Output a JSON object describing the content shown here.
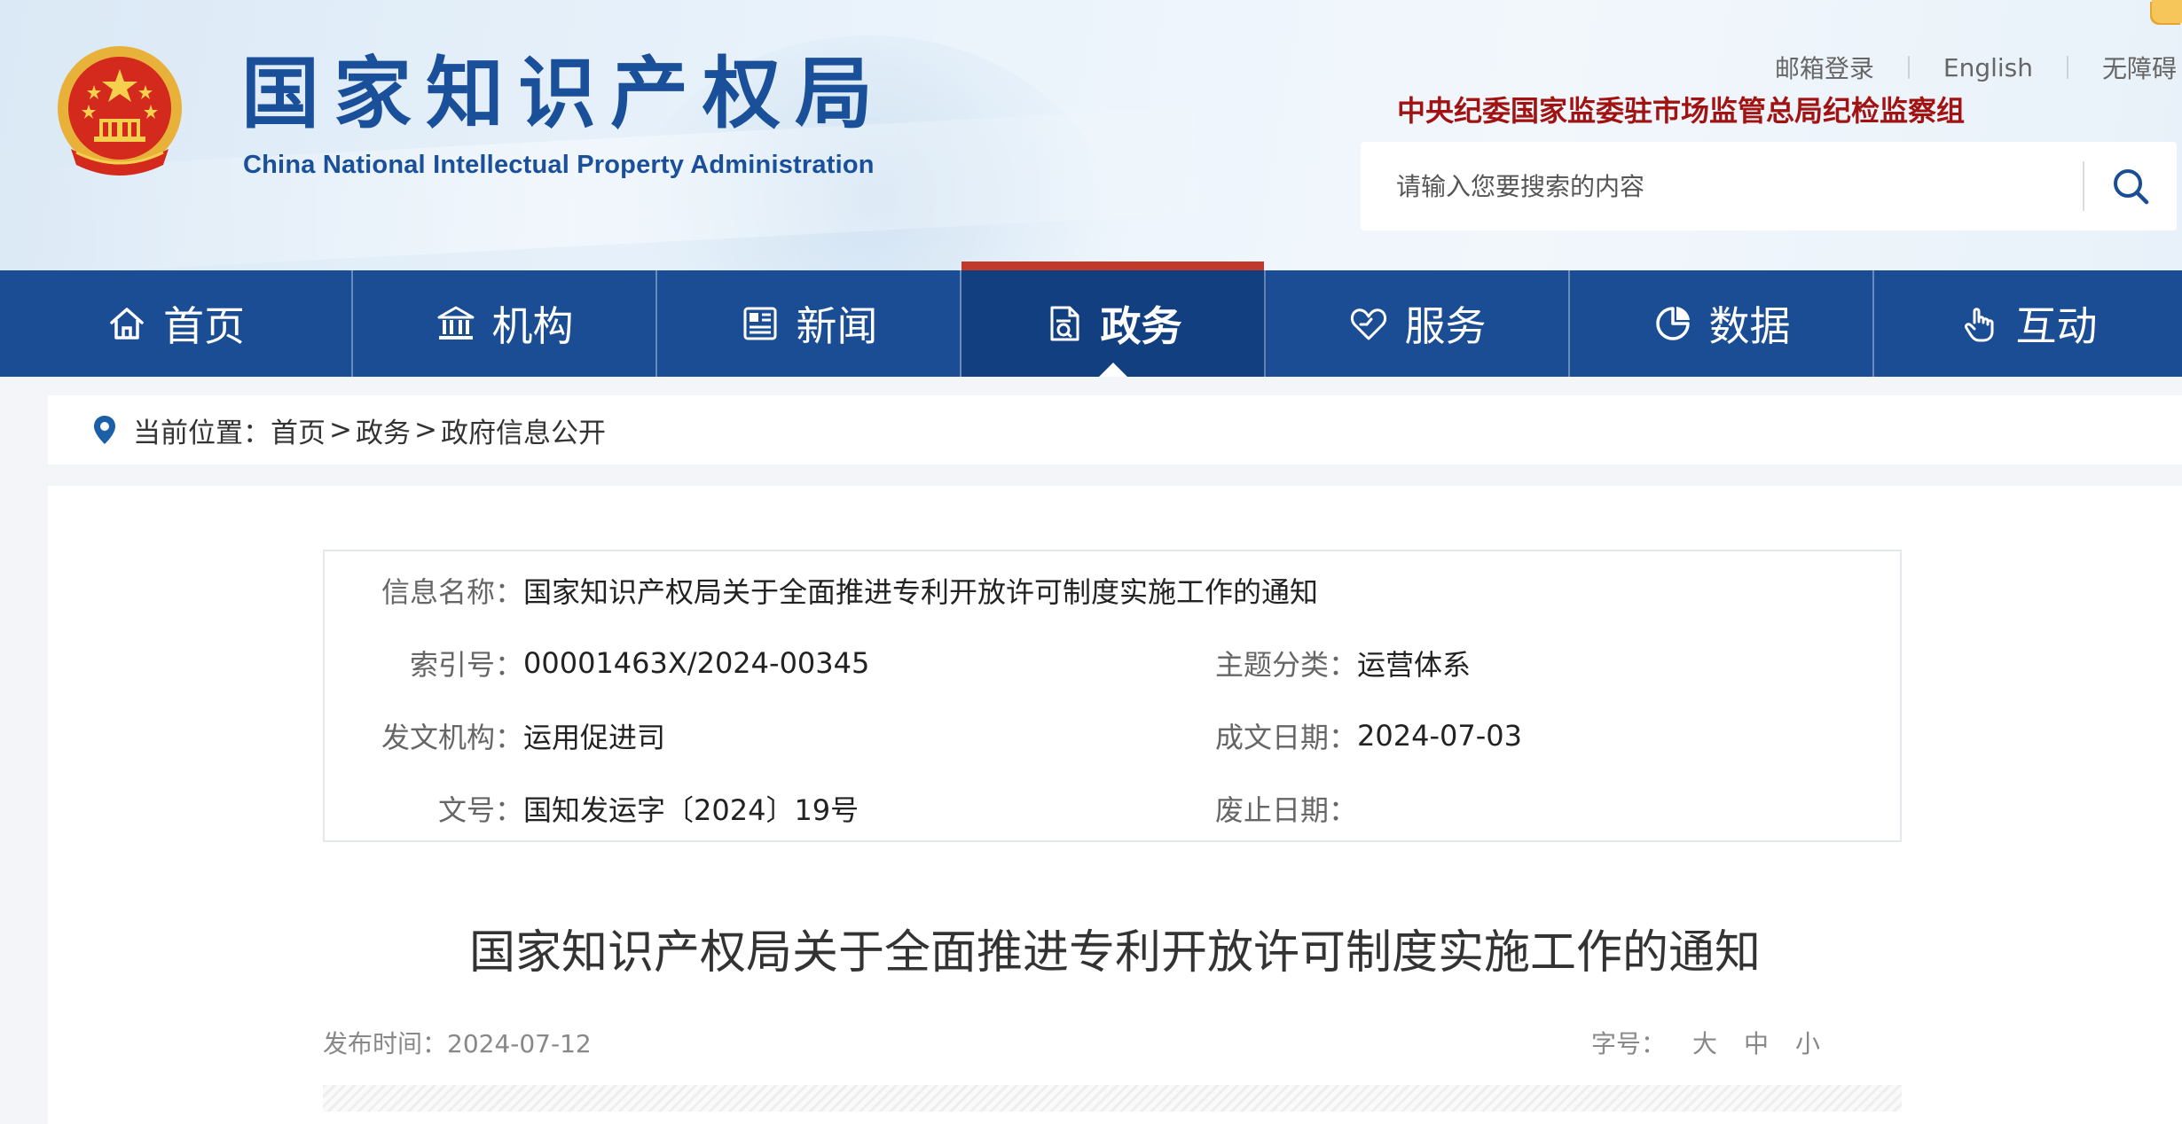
{
  "header": {
    "site_title": "国家知识产权局",
    "site_subtitle": "China National Intellectual Property Administration",
    "top_links": [
      "邮箱登录",
      "English",
      "无障碍"
    ],
    "org_line": "中央纪委国家监委驻市场监管总局纪检监察组",
    "search": {
      "placeholder": "请输入您要搜索的内容"
    }
  },
  "nav": {
    "items": [
      {
        "label": "首页",
        "icon": "home-icon"
      },
      {
        "label": "机构",
        "icon": "institution-icon"
      },
      {
        "label": "新闻",
        "icon": "news-icon"
      },
      {
        "label": "政务",
        "icon": "document-icon",
        "active": true
      },
      {
        "label": "服务",
        "icon": "service-heart-icon"
      },
      {
        "label": "数据",
        "icon": "pie-chart-icon"
      },
      {
        "label": "互动",
        "icon": "hand-pointer-icon"
      }
    ]
  },
  "breadcrumb": {
    "prefix": "当前位置：",
    "items": [
      "首页",
      "政务",
      "政府信息公开"
    ],
    "separator": ">"
  },
  "info": {
    "name_label": "信息名称：",
    "name_value": "国家知识产权局关于全面推进专利开放许可制度实施工作的通知",
    "index_label": "索引号：",
    "index_value": "00001463X/2024-00345",
    "topic_label": "主题分类：",
    "topic_value": "运营体系",
    "issuer_label": "发文机构：",
    "issuer_value": "运用促进司",
    "date_label": "成文日期：",
    "date_value": "2024-07-03",
    "docno_label": "文号：",
    "docno_value": "国知发运字〔2024〕19号",
    "abolish_label": "废止日期：",
    "abolish_value": ""
  },
  "article": {
    "title": "国家知识产权局关于全面推进专利开放许可制度实施工作的通知",
    "publish_time": "发布时间：2024-07-12",
    "font_label": "字号：",
    "font_sizes": [
      "大",
      "中",
      "小"
    ]
  },
  "colors": {
    "nav_bg": "#1a4d93",
    "nav_active_bg": "#123f7f",
    "nav_active_bar": "#c0392b",
    "title_blue": "#1a4f9a",
    "org_red": "#a11212"
  }
}
